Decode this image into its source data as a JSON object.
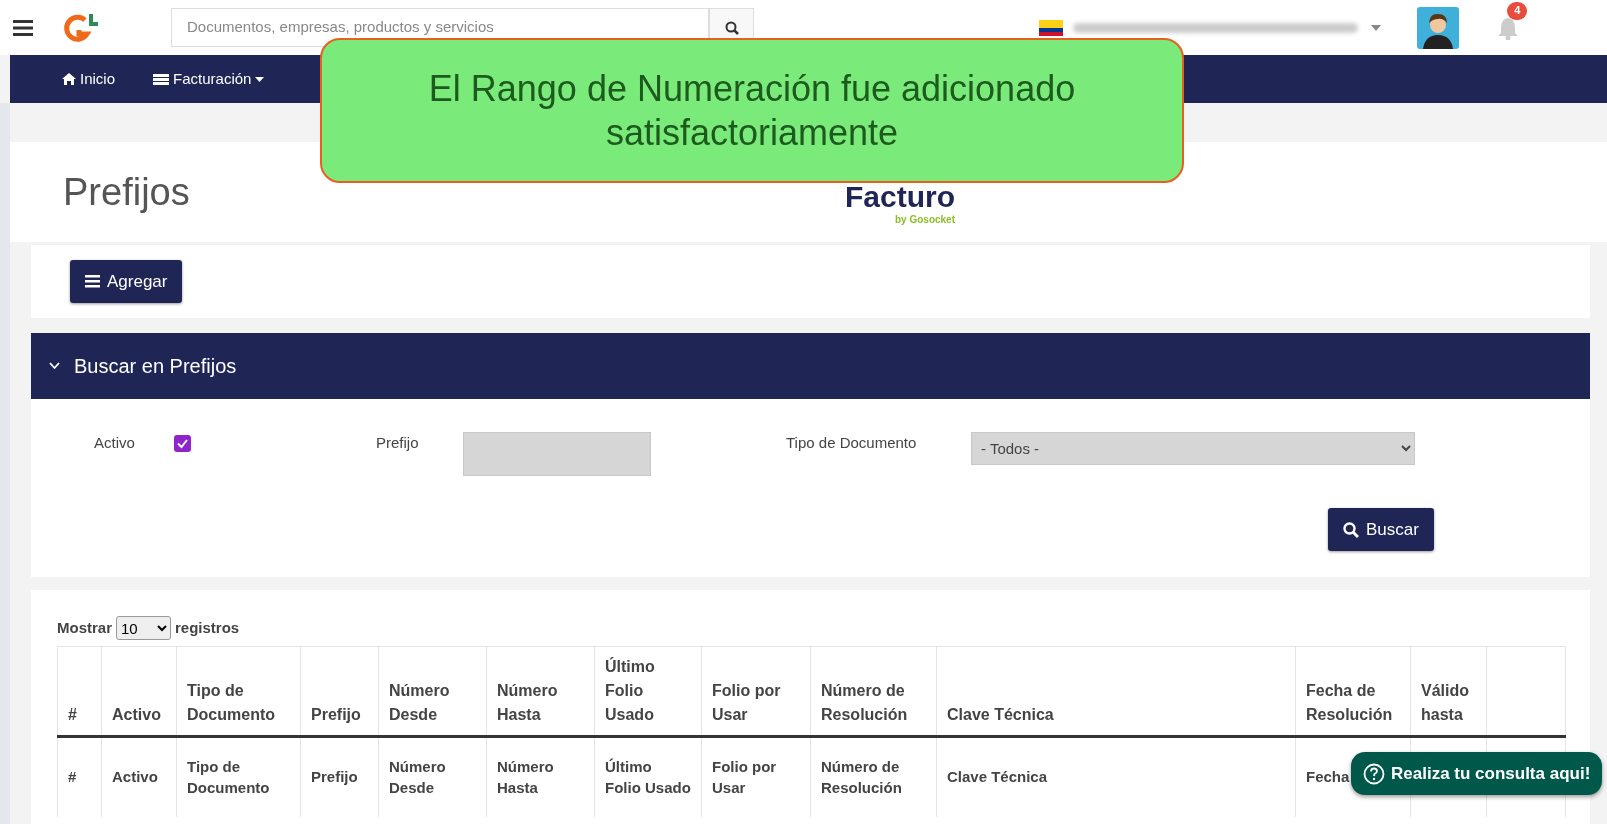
{
  "topbar": {
    "search": {
      "placeholder": "Documentos, empresas, productos y servicios"
    },
    "notifications": "4"
  },
  "nav": [
    {
      "label": "Inicio",
      "dropdown": false
    },
    {
      "label": "Facturación",
      "dropdown": true
    }
  ],
  "toast": {
    "message": "El Rango de Numeración fue adicionado satisfactoriamente"
  },
  "page": {
    "title": "Prefijos",
    "logo": {
      "name": "Facturo",
      "tagline": "by Gosocket"
    }
  },
  "add_button": "Agregar",
  "search_panel": {
    "title": "Buscar en Prefijos",
    "expanded": true,
    "fields": [
      {
        "kind": "checkbox",
        "label": "Activo",
        "checked": true
      },
      {
        "kind": "text",
        "label": "Prefijo"
      },
      {
        "kind": "select",
        "label": "Tipo de Documento",
        "value": "- Todos -"
      }
    ],
    "button": "Buscar"
  },
  "table": {
    "length": {
      "before": "Mostrar",
      "value": "10",
      "after": "registros"
    },
    "columns": [
      "#",
      "Activo",
      "Tipo de Documento",
      "Prefijo",
      "Número Desde",
      "Número Hasta",
      "Último Folio Usado",
      "Folio por Usar",
      "Número de Resolución",
      "Clave Técnica",
      "Fecha de Resolución",
      "Válido hasta"
    ],
    "footer": [
      "#",
      "Activo",
      "Tipo de Documento",
      "Prefijo",
      "Número Desde",
      "Número Hasta",
      "Último Folio Usado",
      "Folio por Usar",
      "Número de Resolución",
      "Clave Técnica",
      "Fecha"
    ]
  },
  "chat_button": "Realiza tu consulta aqui!"
}
